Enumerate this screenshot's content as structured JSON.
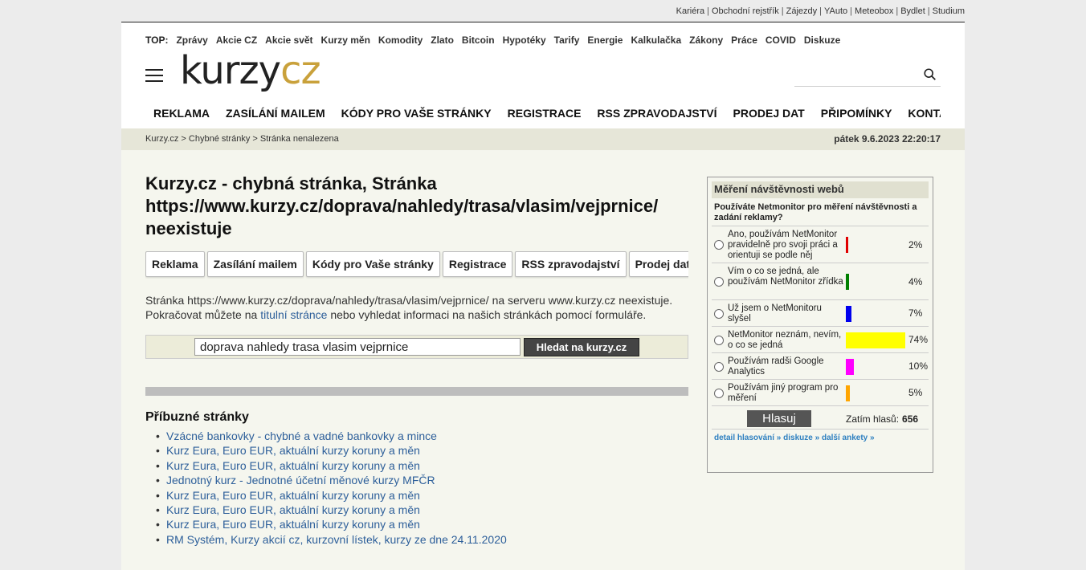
{
  "toplinks": [
    "Kariéra",
    "Obchodní rejstřík",
    "Zájezdy",
    "YAuto",
    "Meteobox",
    "Bydlet",
    "Studium"
  ],
  "topnav": {
    "label": "TOP:",
    "items": [
      "Zprávy",
      "Akcie CZ",
      "Akcie svět",
      "Kurzy měn",
      "Komodity",
      "Zlato",
      "Bitcoin",
      "Hypotéky",
      "Tarify",
      "Energie",
      "Kalkulačka",
      "Zákony",
      "Práce",
      "COVID",
      "Diskuze"
    ]
  },
  "logo": {
    "part1": "kurzy",
    "part2": "cz"
  },
  "search": {
    "placeholder": ""
  },
  "mainnav": [
    "REKLAMA",
    "ZASÍLÁNÍ MAILEM",
    "KÓDY PRO VAŠE STRÁNKY",
    "REGISTRACE",
    "RSS ZPRAVODAJSTVÍ",
    "PRODEJ DAT",
    "PŘIPOMÍNKY",
    "KONTAKTY"
  ],
  "breadcrumb": "Kurzy.cz > Chybné stránky > Stránka nenalezena",
  "datetime": "pátek 9.6.2023 22:20:17",
  "title": {
    "line1": "Kurzy.cz - chybná stránka, Stránka",
    "line2": "https://www.kurzy.cz/doprava/nahledy/trasa/vlasim/vejprnice/",
    "line3": "neexistuje"
  },
  "buttons": [
    "Reklama",
    "Zasílání mailem",
    "Kódy pro Vaše stránky",
    "Registrace",
    "RSS zpravodajství",
    "Prodej dat"
  ],
  "text": {
    "before": "Stránka https://www.kurzy.cz/doprava/nahledy/trasa/vlasim/vejprnice/ na serveru www.kurzy.cz neexistuje. Pokračovat můžete na ",
    "link": "titulní stránce",
    "after": " nebo vyhledat informaci na našich stránkách pomocí formuláře."
  },
  "searchform": {
    "value": "doprava nahledy trasa vlasim vejprnice",
    "button": "Hledat na kurzy.cz"
  },
  "related": {
    "heading": "Příbuzné stránky",
    "items": [
      "Vzácné bankovky - chybné a vadné bankovky a mince",
      "Kurz Eura, Euro EUR, aktuální kurzy koruny a měn",
      "Kurz Eura, Euro EUR, aktuální kurzy koruny a měn",
      "Jednotný kurz - Jednotné účetní měnové kurzy MFČR",
      "Kurz Eura, Euro EUR, aktuální kurzy koruny a měn",
      "Kurz Eura, Euro EUR, aktuální kurzy koruny a měn",
      "Kurz Eura, Euro EUR, aktuální kurzy koruny a měn",
      "RM Systém, Kurzy akcií cz, kurzovní lístek, kurzy ze dne 24.11.2020"
    ]
  },
  "poll": {
    "title": "Měření návštěvnosti webů",
    "question": "Používáte Netmonitor pro měření návštěvnosti a zadání reklamy?",
    "options": [
      {
        "label": "Ano, používám NetMonitor pravidelně pro svoji práci a orientuji se podle něj",
        "pct": "2%",
        "value": 2,
        "color": "#e00000"
      },
      {
        "label": "Vím o co se jedná, ale používám NetMonitor zřídka",
        "pct": "4%",
        "value": 4,
        "color": "#008000"
      },
      {
        "label": "Už jsem o NetMonitoru slyšel",
        "pct": "7%",
        "value": 7,
        "color": "#0000ee"
      },
      {
        "label": "NetMonitor neznám, nevím, o co se jedná",
        "pct": "74%",
        "value": 74,
        "color": "#ffff00"
      },
      {
        "label": "Používám radši Google Analytics",
        "pct": "10%",
        "value": 10,
        "color": "#ff00ff"
      },
      {
        "label": "Používám jiný program pro měření",
        "pct": "5%",
        "value": 5,
        "color": "#ffa500"
      }
    ],
    "vote_label": "Hlasuj",
    "total_label": "Zatím hlasů:",
    "total": "656",
    "links": [
      "detail hlasování »",
      "diskuze »",
      "další ankety »"
    ]
  }
}
